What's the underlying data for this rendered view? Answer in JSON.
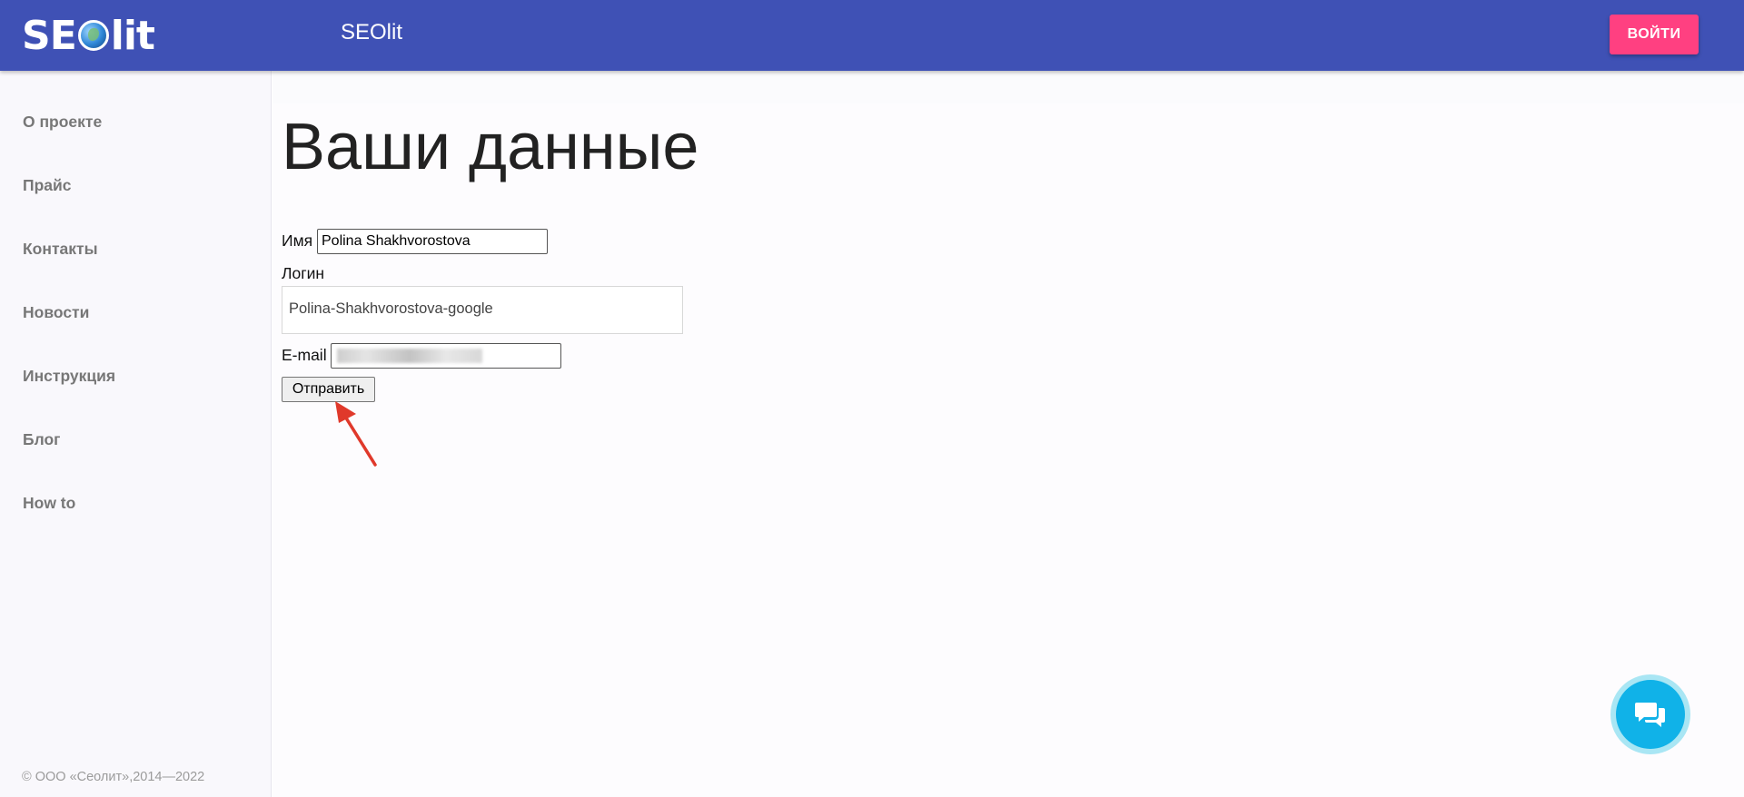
{
  "header": {
    "logo_text_left": "SE",
    "logo_text_right": "lit",
    "app_title": "SEOlit",
    "login_label": "ВОЙТИ"
  },
  "sidebar": {
    "items": [
      {
        "label": "О проекте"
      },
      {
        "label": "Прайс"
      },
      {
        "label": "Контакты"
      },
      {
        "label": "Новости"
      },
      {
        "label": "Инструкция"
      },
      {
        "label": "Блог"
      },
      {
        "label": "How to"
      }
    ],
    "copyright": "© ООО «Сеолит»,2014—2022"
  },
  "main": {
    "title": "Ваши данные",
    "form": {
      "name_label": "Имя",
      "name_value": "Polina Shakhvorostova",
      "login_label": "Логин",
      "login_value": "Polina-Shakhvorostova-google",
      "email_label": "E-mail",
      "email_value": "",
      "submit_label": "Отправить"
    }
  },
  "colors": {
    "header_bg": "#3f51b5",
    "login_button_bg": "#ff4081",
    "chat_button": "#10b2e8",
    "annotation_arrow": "#e0392b"
  },
  "icons": {
    "logo_globe": "globe-icon",
    "chat": "chat-bubbles-icon",
    "annotation": "red-arrow-icon"
  }
}
